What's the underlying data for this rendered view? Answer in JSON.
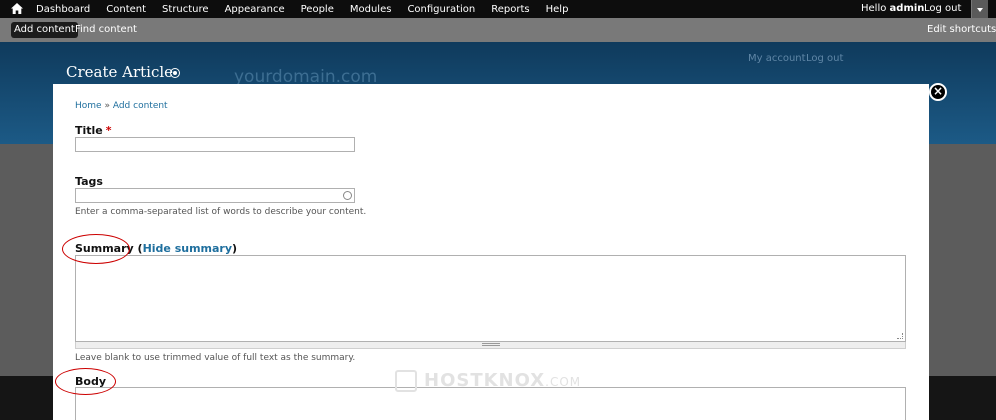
{
  "toolbar": {
    "menu": [
      "Dashboard",
      "Content",
      "Structure",
      "Appearance",
      "People",
      "Modules",
      "Configuration",
      "Reports",
      "Help"
    ],
    "hello": "Hello ",
    "username": "admin",
    "logout": "Log out"
  },
  "shortcuts": {
    "add_content": "Add content",
    "find_content": "Find content",
    "edit_shortcuts": "Edit shortcuts"
  },
  "header": {
    "page_title": "Create Article",
    "site_name": "yourdomain.com",
    "my_account": "My account",
    "log_out": "Log out"
  },
  "breadcrumb": {
    "home": "Home",
    "separator": "»",
    "add_content": "Add content"
  },
  "form": {
    "title_label": "Title",
    "required_mark": "*",
    "title_value": "",
    "tags_label": "Tags",
    "tags_value": "",
    "tags_description": "Enter a comma-separated list of words to describe your content.",
    "summary_label": "Summary",
    "summary_open": " (",
    "hide_summary": "Hide summary",
    "summary_close": ")",
    "summary_value": "",
    "summary_description": "Leave blank to use trimmed value of full text as the summary.",
    "body_label": "Body",
    "body_value": ""
  },
  "watermark": {
    "brand": "HOSTKNOX",
    "suffix": ".COM"
  },
  "colors": {
    "toolbar_bg": "#0d0d0d",
    "shortcuts_bg": "#797979",
    "header_bg": "#1c5a86",
    "link": "#1f6f9e",
    "highlight_ring": "#cc0000"
  }
}
